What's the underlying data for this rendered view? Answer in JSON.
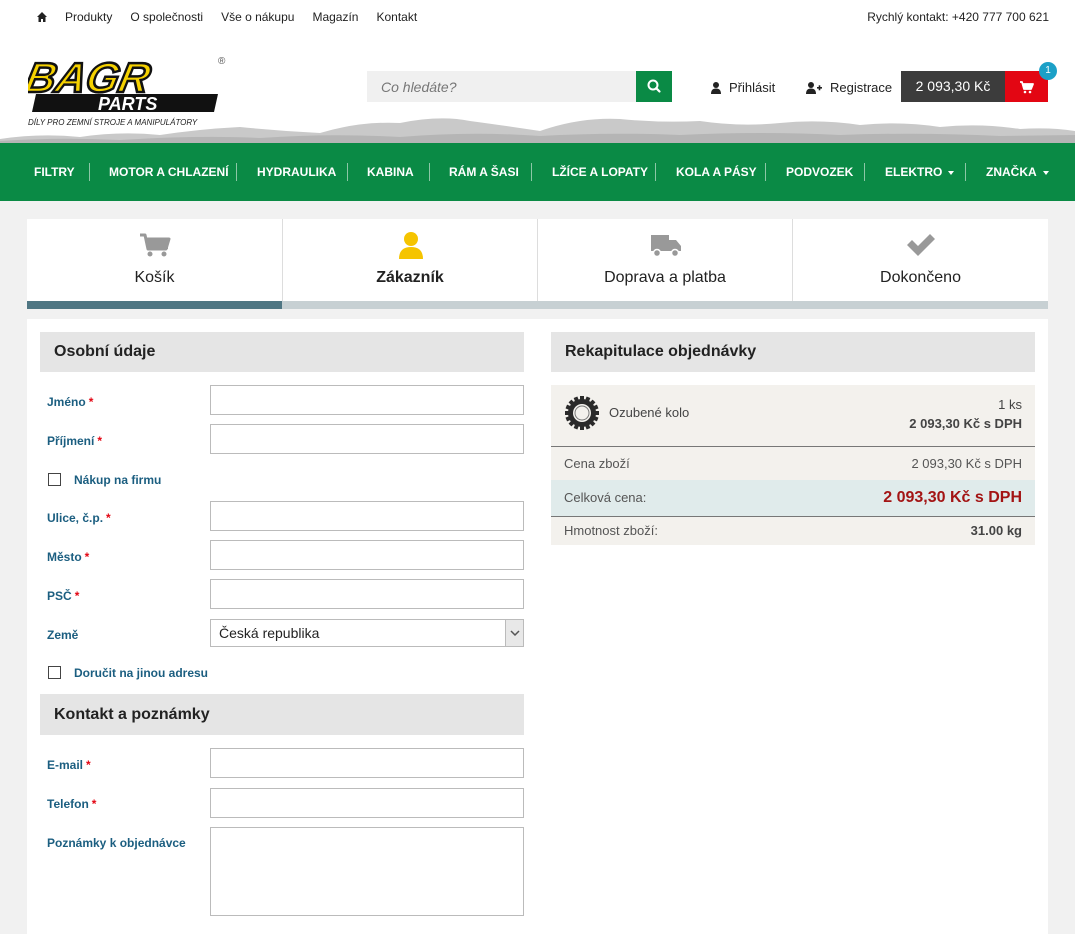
{
  "topbar": {
    "links": [
      "Produkty",
      "O společnosti",
      "Vše o nákupu",
      "Magazín",
      "Kontakt"
    ],
    "quick_contact": "Rychlý kontakt: +420 777 700 621"
  },
  "header": {
    "logo_text": "BAGR PARTS",
    "logo_tagline": "DÍLY PRO ZEMNÍ STROJE A MANIPULÁTORY",
    "search_placeholder": "Co hledáte?",
    "login": "Přihlásit",
    "register": "Registrace",
    "cart_total": "2 093,30 Kč",
    "cart_count": "1"
  },
  "nav": {
    "items": [
      "FILTRY",
      "MOTOR A CHLAZENÍ",
      "HYDRAULIKA",
      "KABINA",
      "RÁM A ŠASI",
      "LŽÍCE A LOPATY",
      "KOLA A PÁSY",
      "PODVOZEK",
      "ELEKTRO",
      "ZNAČKA"
    ]
  },
  "steps": {
    "items": [
      {
        "label": "Košík",
        "icon": "cart-icon"
      },
      {
        "label": "Zákazník",
        "icon": "user-icon"
      },
      {
        "label": "Doprava a platba",
        "icon": "truck-icon"
      },
      {
        "label": "Dokončeno",
        "icon": "check-icon"
      }
    ],
    "active": 1,
    "progress": 0.25,
    "colors": {
      "active_icon": "#f5c400",
      "inactive_icon": "#999999",
      "progress": "#4f7683"
    }
  },
  "personal": {
    "title": "Osobní údaje",
    "first_name": "Jméno",
    "last_name": "Příjmení",
    "company_purchase": "Nákup na firmu",
    "street": "Ulice, č.p.",
    "city": "Město",
    "zip": "PSČ",
    "country_label": "Země",
    "country_value": "Česká republika",
    "other_address": "Doručit na jinou adresu"
  },
  "contact": {
    "title": "Kontakt a poznámky",
    "email": "E-mail",
    "phone": "Telefon",
    "notes": "Poznámky k objednávce"
  },
  "summary": {
    "title": "Rekapitulace objednávky",
    "product_name": "Ozubené kolo",
    "product_qty": "1 ks",
    "product_price": "2 093,30 Kč s DPH",
    "goods_price_label": "Cena zboží",
    "goods_price_value": "2 093,30 Kč s DPH",
    "total_label": "Celková cena:",
    "total_value": "2 093,30 Kč s DPH",
    "weight_label": "Hmotnost zboží:",
    "weight_value": "31.00 kg"
  },
  "colors": {
    "green": "#0a8a45",
    "red": "#e30613",
    "link_blue": "#1b5e80",
    "total_red": "#a31414",
    "badge": "#1ba0c7"
  }
}
